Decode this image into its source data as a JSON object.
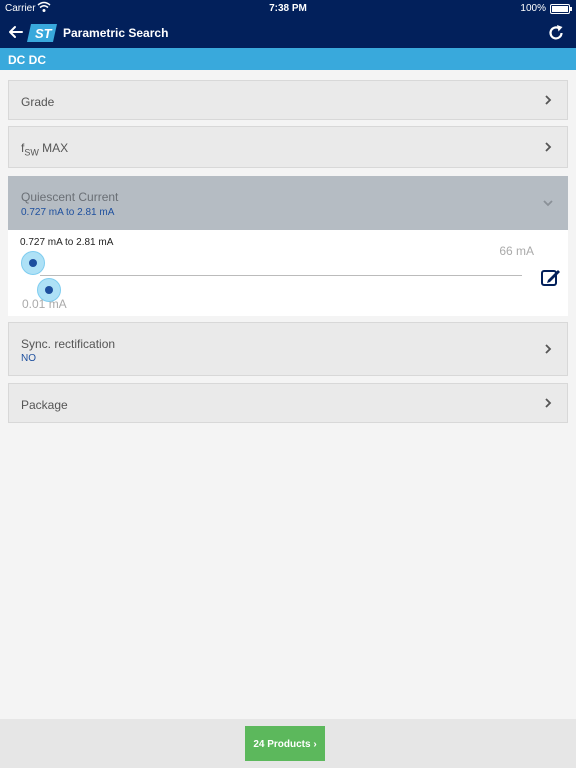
{
  "status_bar": {
    "carrier": "Carrier",
    "time": "7:38 PM",
    "battery": "100%"
  },
  "navbar": {
    "title": "Parametric Search",
    "logo": "ST"
  },
  "section": {
    "title": "DC DC"
  },
  "filters": [
    {
      "label": "Grade"
    },
    {
      "label_prefix": "f",
      "label_sub": "SW",
      "label_suffix": " MAX"
    },
    {
      "label": "Quiescent Current",
      "value": "0.727 mA to 2.81 mA"
    },
    {
      "label": "Sync. rectification",
      "value": "NO"
    },
    {
      "label": "Package"
    }
  ],
  "slider": {
    "range_text": "0.727 mA to 2.81 mA",
    "min_label": "0.01 mA",
    "max_label": "66 mA",
    "low_value": 0.727,
    "high_value": 2.81,
    "min_value": 0.01,
    "max_value": 66
  },
  "footer": {
    "products_label": "24 Products"
  },
  "colors": {
    "navbar": "#02205b",
    "section_band": "#39a9dc",
    "accent_text": "#1d4f9e",
    "products_button": "#5cb85c"
  }
}
